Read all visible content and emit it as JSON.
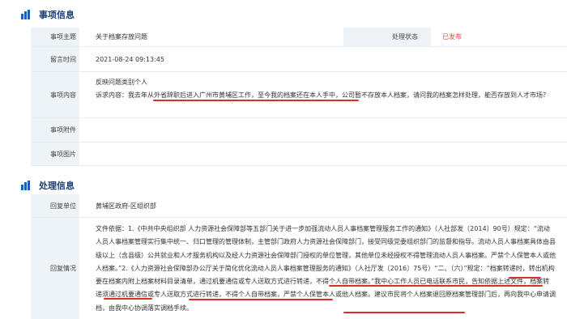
{
  "sections": {
    "matter_title": "事项信息",
    "process_title": "处理信息"
  },
  "matter": {
    "subject_label": "事项主题",
    "subject_value": "关于档案存放问题",
    "status_label": "处理状态",
    "status_value": "已发布",
    "time_label": "留言时间",
    "time_value": "2021-08-24 09:13:45",
    "content_label": "事项内容",
    "content_line1": "反映问题类别个人",
    "content_line2": "诉求内容：我去年从外省辞职后进入广州市黄埔区工作，至今我的档案还在本人手中，公司暂不存放本人档案，请问我的档案怎样处理，能否存放到人才市场？",
    "attachment_label": "事项附件",
    "attachment_value": "",
    "image_label": "事项图片",
    "image_value": ""
  },
  "process": {
    "unit_label": "回复单位",
    "unit_value": "黄埔区政府-区组织部",
    "reply_label": "回复情况",
    "reply_value": "文件依据：1.《中共中央组织部 人力资源社会保障部等五部门关于进一步加强流动人员人事档案管理服务工作的通知》（人社部发〔2014〕90号）规定：“流动人员人事档案管理实行集中统一、归口管理的管理体制，主管部门政府人力资源社会保障部门，接受同级党委组织部门的监督和指导。流动人员人事档案具体由县级以上（含县级）公共就业和人才服务机构以及经人力资源社会保障部门授权的单位管理，其他单位未经授权不得管理流动人员人事档案。严禁个人保管本人或他人档案。”2.《人力资源社会保障部办公厅关于简化优化流动人员人事档案管理服务的通知》（人社厅发〔2016〕75号）“二、（六）”规定：“档案转递时，转出机构要在档案内附上档案材料目录清单，通过机要通信或专人送取方式进行转递，不得个人自带档案。”我中心工作人员已电话联系市民，告知依据上述文件，档案转递须通过机要通信或专人送取方式进行转递，不得个人自带档案，严禁个人保管本人或他人档案。建议市民将个人档案退回原档案管理部门后，再向我中心申请调档，由我中心协调落实调档手续。"
  },
  "colors": {
    "header_title": "#1a3f73",
    "label_bg": "#eef3f8",
    "status_red": "#e84a3f",
    "underline_red": "#d93025"
  }
}
